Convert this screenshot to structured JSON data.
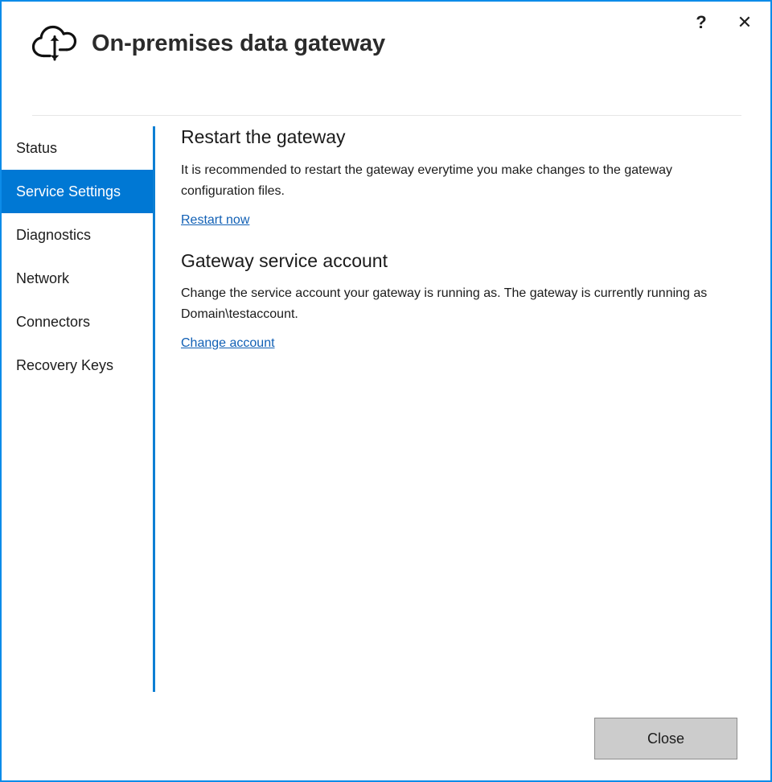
{
  "window": {
    "title": "On-premises data gateway",
    "accent_color": "#0078d4",
    "border_color": "#0c8ce9",
    "icon": "cloud-sync-icon"
  },
  "titlebar": {
    "help_label": "?",
    "help_icon": "question-mark-icon",
    "close_label": "✕",
    "close_icon": "close-x-icon"
  },
  "sidebar": {
    "items": [
      {
        "label": "Status",
        "selected": false
      },
      {
        "label": "Service Settings",
        "selected": true
      },
      {
        "label": "Diagnostics",
        "selected": false
      },
      {
        "label": "Network",
        "selected": false
      },
      {
        "label": "Connectors",
        "selected": false
      },
      {
        "label": "Recovery Keys",
        "selected": false
      }
    ]
  },
  "main": {
    "sections": [
      {
        "heading": "Restart the gateway",
        "body": "It is recommended to restart the gateway everytime you make changes to the gateway configuration files.",
        "link": "Restart now"
      },
      {
        "heading": "Gateway service account",
        "body": "Change the service account your gateway is running as. The gateway is currently running as Domain\\testaccount.",
        "link": "Change account"
      }
    ]
  },
  "footer": {
    "close_button_label": "Close"
  }
}
